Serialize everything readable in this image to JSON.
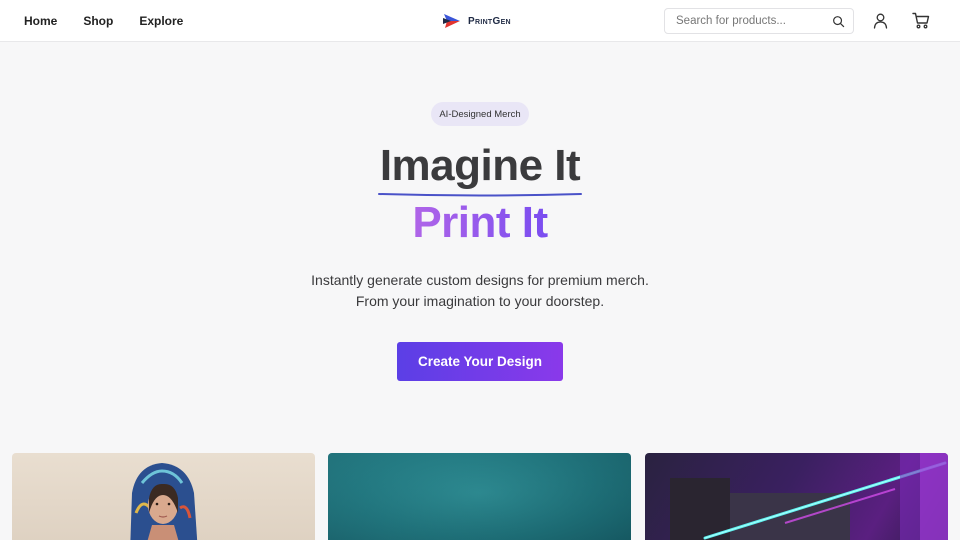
{
  "header": {
    "nav": [
      {
        "label": "Home"
      },
      {
        "label": "Shop"
      },
      {
        "label": "Explore"
      }
    ],
    "brand": "PrintGen",
    "search": {
      "placeholder": "Search for products...",
      "value": ""
    },
    "icons": {
      "search": "search-icon",
      "user": "user-icon",
      "cart": "cart-icon"
    }
  },
  "hero": {
    "badge": "AI-Designed Merch",
    "title_line1": "Imagine It",
    "title_line2": "Print It",
    "subtitle_line1": "Instantly generate custom designs for premium merch.",
    "subtitle_line2": "From your imagination to your doorstep.",
    "cta": "Create Your Design"
  },
  "colors": {
    "accent_start": "#5b3fe6",
    "accent_end": "#8a39ea",
    "gradient_text_start": "#b065e8",
    "gradient_text_end": "#7a4df0",
    "underline": "#4a52c8"
  },
  "products": [
    {
      "image": "woman-in-printed-hoodie"
    },
    {
      "image": "teal-textured-backdrop"
    },
    {
      "image": "neon-lit-building"
    }
  ]
}
